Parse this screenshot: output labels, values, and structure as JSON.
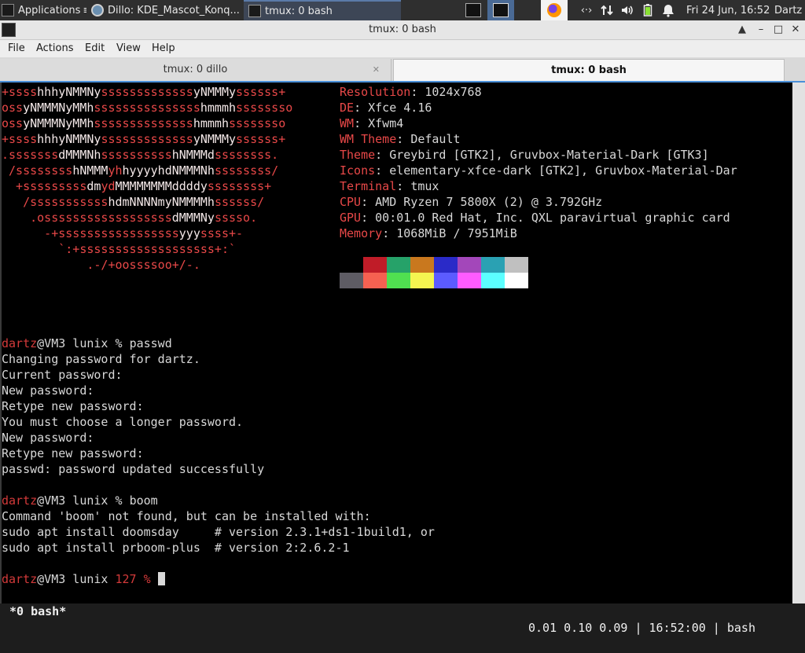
{
  "taskbar": {
    "apps_label": "Applications",
    "tasks": [
      "Dillo: KDE_Mascot_Konq...",
      "tmux: 0 bash"
    ],
    "clock": "Fri 24 Jun, 16:52",
    "user": "Dartz",
    "net_label": "‹·›",
    "icons": [
      "terminal-icon",
      "firefox-icon",
      "network-icon",
      "updown-arrows-icon",
      "volume-icon",
      "battery-icon",
      "bell-icon"
    ]
  },
  "window": {
    "title": "tmux: 0 bash",
    "buttons": [
      "▲",
      "–",
      "□",
      "✕"
    ]
  },
  "menu": {
    "items": [
      "File",
      "Actions",
      "Edit",
      "View",
      "Help"
    ]
  },
  "tabs": [
    {
      "label": "tmux: 0 dillo",
      "close": "✕"
    },
    {
      "label": "tmux: 0 bash"
    }
  ],
  "neofetch": {
    "art": [
      [
        "+ssss",
        "hhhyNMMNy",
        "sssssssssssss",
        "yNMMMy",
        "ssssss+"
      ],
      [
        "oss",
        "yNMMMNyMMh",
        "sssssssssssssss",
        "hmmmh",
        "ssssssso"
      ],
      [
        "oss",
        "yNMMMNyMMh",
        "ssssssssssssss",
        "hmmmh",
        "ssssssso"
      ],
      [
        "+ssss",
        "hhhyNMMNy",
        "sssssssssssss",
        "yNMMMy",
        "ssssss+"
      ],
      [
        ".sssssss",
        "dMMMNh",
        "ssssssssss",
        "hNMMMd",
        "ssssssss."
      ],
      [
        " /ssssssss",
        "hNMMM",
        "yh",
        "hyyyyhdNMMMNh",
        "ssssssss/"
      ],
      [
        "  +sssssssss",
        "dm",
        "yd",
        "MMMMMMMMddddy",
        "ssssssss+"
      ],
      [
        "   /sssssssssss",
        "hdmNNNNmyNMMMMh",
        "ssssss/"
      ],
      [
        "    .ossssssssssssssssss",
        "dMMMNy",
        "sssso."
      ],
      [
        "      -+sssssssssssssssss",
        "yyy",
        "ssss+-"
      ],
      [
        "        `:+sssssssssssssssssss+:`"
      ],
      [
        "            .-/+oossssoo+/-."
      ]
    ],
    "info": [
      {
        "label": "Resolution",
        "value": "1024x768"
      },
      {
        "label": "DE",
        "value": "Xfce 4.16"
      },
      {
        "label": "WM",
        "value": "Xfwm4"
      },
      {
        "label": "WM Theme",
        "value": "Default"
      },
      {
        "label": "Theme",
        "value": "Greybird [GTK2], Gruvbox-Material-Dark [GTK3]"
      },
      {
        "label": "Icons",
        "value": "elementary-xfce-dark [GTK2], Gruvbox-Material-Dar"
      },
      {
        "label": "Terminal",
        "value": "tmux"
      },
      {
        "label": "CPU",
        "value": "AMD Ryzen 7 5800X (2) @ 3.792GHz"
      },
      {
        "label": "GPU",
        "value": "00:01.0 Red Hat, Inc. QXL paravirtual graphic card"
      },
      {
        "label": "Memory",
        "value": "1068MiB / 7951MiB"
      }
    ],
    "palette_top": [
      "#000000",
      "#c01c28",
      "#26a269",
      "#c9781e",
      "#2a2ac8",
      "#a347ba",
      "#2aa1b3",
      "#c0c0c0"
    ],
    "palette_bottom": [
      "#5e5c64",
      "#f66151",
      "#50e050",
      "#f5f550",
      "#5b5bff",
      "#ff5bff",
      "#5bffff",
      "#ffffff"
    ]
  },
  "session": {
    "user": "dartz",
    "host_path": "@VM3 lunix % ",
    "cmd1": "passwd",
    "out1": [
      "Changing password for dartz.",
      "Current password:",
      "New password:",
      "Retype new password:",
      "You must choose a longer password.",
      "New password:",
      "Retype new password:",
      "passwd: password updated successfully"
    ],
    "cmd2": "boom",
    "out2": [
      "Command 'boom' not found, but can be installed with:",
      "sudo apt install doomsday     # version 2.3.1+ds1-1build1, or",
      "sudo apt install prboom-plus  # version 2:2.6.2-1"
    ],
    "prompt3_host": "@VM3 lunix ",
    "prompt3_code": "127 %"
  },
  "status": {
    "left": "*0 bash*",
    "right": "0.01 0.10 0.09 | 16:52:00 | bash"
  }
}
